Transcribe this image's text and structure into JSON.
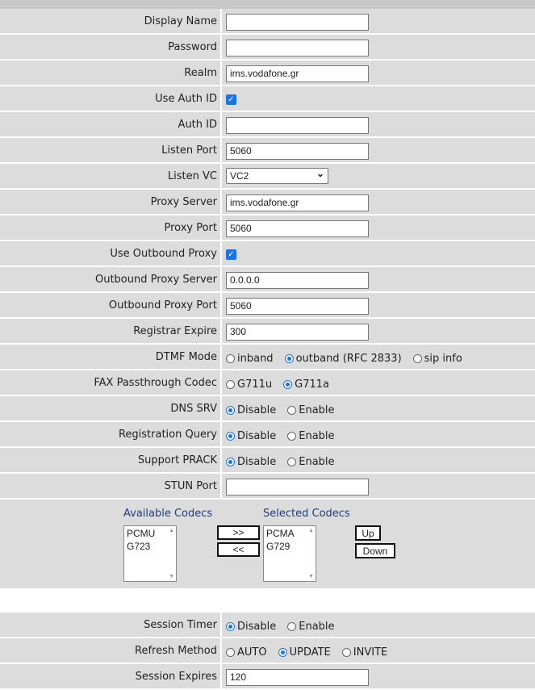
{
  "rows": [
    {
      "label": "Display Name",
      "type": "text",
      "value": ""
    },
    {
      "label": "Password",
      "type": "text",
      "value": ""
    },
    {
      "label": "Realm",
      "type": "text",
      "value": "ims.vodafone.gr"
    },
    {
      "label": "Use Auth ID",
      "type": "check",
      "checked": true
    },
    {
      "label": "Auth ID",
      "type": "text",
      "value": ""
    },
    {
      "label": "Listen Port",
      "type": "text",
      "value": "5060"
    },
    {
      "label": "Listen VC",
      "type": "select",
      "value": "VC2"
    },
    {
      "label": "Proxy Server",
      "type": "text",
      "value": "ims.vodafone.gr"
    },
    {
      "label": "Proxy Port",
      "type": "text",
      "value": "5060"
    },
    {
      "label": "Use Outbound Proxy",
      "type": "check",
      "checked": true
    },
    {
      "label": "Outbound Proxy Server",
      "type": "text",
      "value": "0.0.0.0"
    },
    {
      "label": "Outbound Proxy Port",
      "type": "text",
      "value": "5060"
    },
    {
      "label": "Registrar Expire",
      "type": "text",
      "value": "300"
    },
    {
      "label": "DTMF Mode",
      "type": "radio",
      "options": [
        "inband",
        "outband (RFC 2833)",
        "sip info"
      ],
      "selected": 1
    },
    {
      "label": "FAX Passthrough Codec",
      "type": "radio",
      "options": [
        "G711u",
        "G711a"
      ],
      "selected": 1
    },
    {
      "label": "DNS SRV",
      "type": "radio",
      "options": [
        "Disable",
        "Enable"
      ],
      "selected": 0
    },
    {
      "label": "Registration Query",
      "type": "radio",
      "options": [
        "Disable",
        "Enable"
      ],
      "selected": 0
    },
    {
      "label": "Support PRACK",
      "type": "radio",
      "options": [
        "Disable",
        "Enable"
      ],
      "selected": 0
    },
    {
      "label": "STUN Port",
      "type": "text",
      "value": ""
    }
  ],
  "codecs": {
    "available_label": "Available Codecs",
    "selected_label": "Selected Codecs",
    "available": [
      "PCMU",
      "G723"
    ],
    "selected": [
      "PCMA",
      "G729"
    ],
    "add_label": ">>",
    "remove_label": "<<",
    "up_label": "Up",
    "down_label": "Down"
  },
  "rows2": [
    {
      "label": "Session Timer",
      "type": "radio",
      "options": [
        "Disable",
        "Enable"
      ],
      "selected": 0
    },
    {
      "label": "Refresh Method",
      "type": "radio",
      "options": [
        "AUTO",
        "UPDATE",
        "INVITE"
      ],
      "selected": 1
    },
    {
      "label": "Session Expires",
      "type": "text",
      "value": "120"
    }
  ]
}
